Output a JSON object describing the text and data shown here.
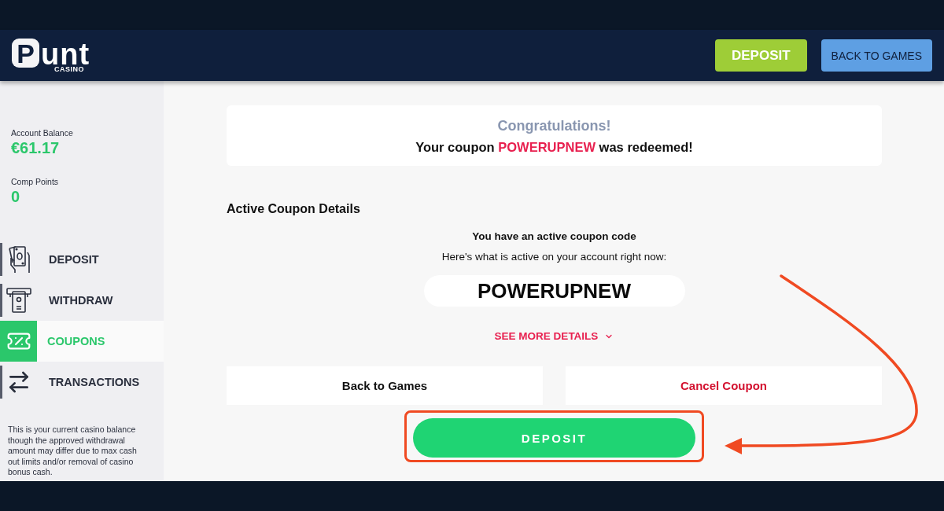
{
  "header": {
    "logo": {
      "wordmark": "Punt",
      "tagline": "CASINO"
    },
    "buttons": [
      {
        "label": "DEPOSIT",
        "kind": "primary"
      },
      {
        "label": "BACK TO GAMES",
        "kind": "secondary"
      }
    ]
  },
  "sidebar": {
    "stats": [
      {
        "label": "Account Balance",
        "value": "€61.17"
      },
      {
        "label": "Comp Points",
        "value": "0"
      }
    ],
    "nav": [
      {
        "label": "DEPOSIT",
        "selected": false
      },
      {
        "label": "WITHDRAW",
        "selected": false
      },
      {
        "label": "COUPONS",
        "selected": true
      },
      {
        "label": "TRANSACTIONS",
        "selected": false
      }
    ],
    "note": "This is your current casino balance though the approved withdrawal amount may differ due to max cash out limits and/or removal of casino bonus cash."
  },
  "main": {
    "notice": {
      "title": "Congratulations!",
      "message": {
        "before": "Your coupon",
        "code": "POWERUPNEW",
        "after": "was redeemed!"
      }
    },
    "section_title": "Active Coupon Details",
    "subtitle": "You have an active coupon code",
    "description": "Here's what is active on your account right now:",
    "coupon_code": "POWERUPNEW",
    "details_link": {
      "label": "SEE MORE DETAILS",
      "expanded": false
    },
    "actions": [
      {
        "label": "Back to Games",
        "kind": "neutral"
      },
      {
        "label": "Cancel Coupon",
        "kind": "danger"
      }
    ],
    "deposit_button": {
      "label": "DEPOSIT",
      "highlighted": true
    }
  }
}
